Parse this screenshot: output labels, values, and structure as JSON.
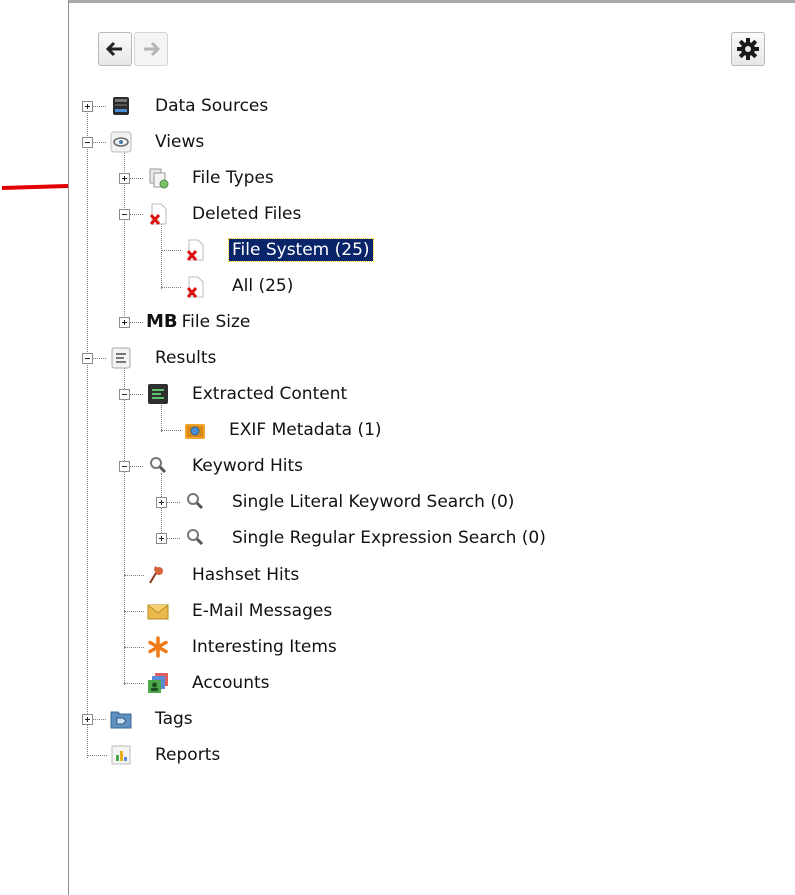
{
  "toolbar": {
    "back_icon": "arrow-left-icon",
    "forward_icon": "arrow-right-icon",
    "settings_icon": "gear-icon"
  },
  "tree": {
    "data_sources": "Data Sources",
    "views": "Views",
    "file_types": "File Types",
    "deleted_files": "Deleted Files",
    "file_system": "File System (25)",
    "all": "All (25)",
    "file_size_prefix": "MB",
    "file_size": "File Size",
    "results": "Results",
    "extracted_content": "Extracted Content",
    "exif_metadata": "EXIF Metadata (1)",
    "keyword_hits": "Keyword Hits",
    "single_literal": "Single Literal Keyword Search (0)",
    "single_regex": "Single Regular Expression Search (0)",
    "hashset_hits": "Hashset Hits",
    "email_messages": "E-Mail Messages",
    "interesting_items": "Interesting Items",
    "accounts": "Accounts",
    "tags": "Tags",
    "reports": "Reports"
  },
  "colors": {
    "selection": "#0a246a",
    "annotation_arrow": "#e00000",
    "deleted_x": "#dd1111"
  }
}
